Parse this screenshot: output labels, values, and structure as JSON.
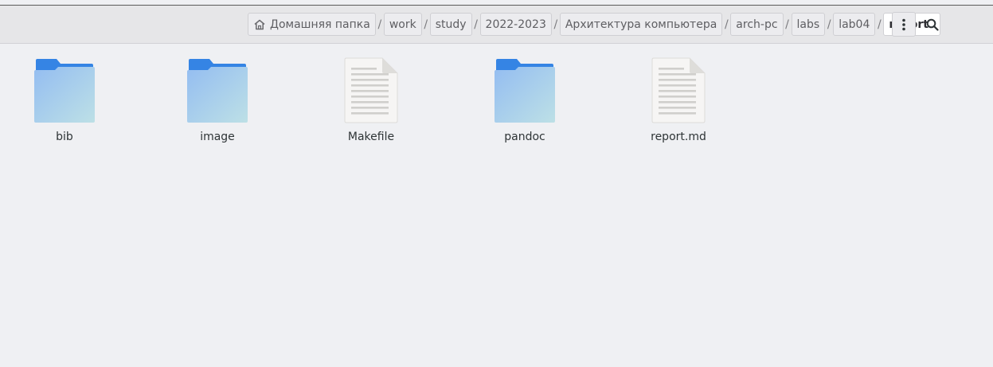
{
  "pathbar": {
    "crumbs": [
      "Домашняя папка",
      "work",
      "study",
      "2022-2023",
      "Архитектура компьютера",
      "arch-pc",
      "labs",
      "lab04"
    ],
    "current": "report",
    "separator": "/"
  },
  "files": [
    {
      "name": "bib",
      "type": "folder"
    },
    {
      "name": "image",
      "type": "folder"
    },
    {
      "name": "Makefile",
      "type": "text"
    },
    {
      "name": "pandoc",
      "type": "folder"
    },
    {
      "name": "report.md",
      "type": "text"
    }
  ],
  "icons": {
    "home": "home-icon",
    "menu": "kebab-menu-icon",
    "search": "search-icon",
    "folder": "folder-icon",
    "text": "text-file-icon"
  },
  "colors": {
    "folder_back": "#3584e4",
    "folder_front_top": "#99c1f1",
    "folder_front_bottom": "#b9dbe8",
    "background": "#eff0f3"
  }
}
